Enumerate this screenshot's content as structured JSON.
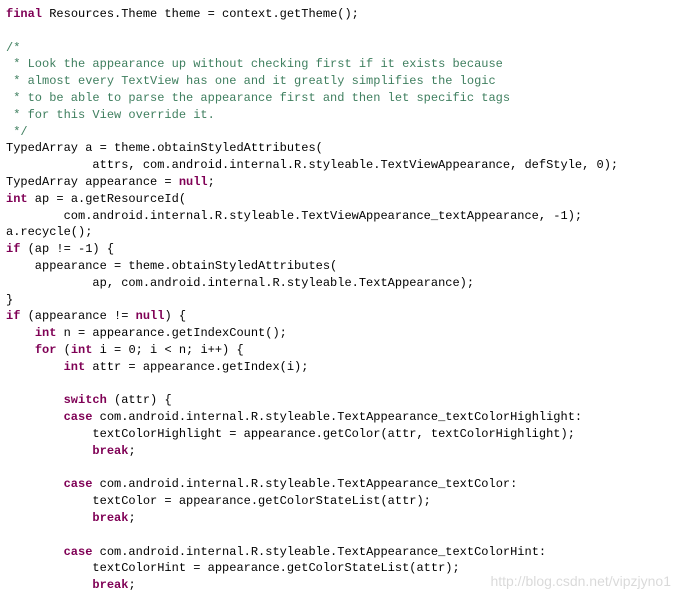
{
  "lines": [
    {
      "segments": [
        {
          "t": "final",
          "c": "keyword"
        },
        {
          "t": " Resources.Theme theme = context.getTheme();",
          "c": "literal"
        }
      ]
    },
    {
      "segments": [
        {
          "t": "",
          "c": "literal"
        }
      ]
    },
    {
      "segments": [
        {
          "t": "/*",
          "c": "comment"
        }
      ]
    },
    {
      "segments": [
        {
          "t": " * Look the appearance up without checking first if it exists because",
          "c": "comment"
        }
      ]
    },
    {
      "segments": [
        {
          "t": " * almost every TextView has one and it greatly simplifies the logic",
          "c": "comment"
        }
      ]
    },
    {
      "segments": [
        {
          "t": " * to be able to parse the appearance first and then let specific tags",
          "c": "comment"
        }
      ]
    },
    {
      "segments": [
        {
          "t": " * for this View override it.",
          "c": "comment"
        }
      ]
    },
    {
      "segments": [
        {
          "t": " */",
          "c": "comment"
        }
      ]
    },
    {
      "segments": [
        {
          "t": "TypedArray a = theme.obtainStyledAttributes(",
          "c": "literal"
        }
      ]
    },
    {
      "segments": [
        {
          "t": "            attrs, com.android.internal.R.styleable.TextViewAppearance, defStyle, 0);",
          "c": "literal"
        }
      ]
    },
    {
      "segments": [
        {
          "t": "TypedArray appearance = ",
          "c": "literal"
        },
        {
          "t": "null",
          "c": "keyword"
        },
        {
          "t": ";",
          "c": "literal"
        }
      ]
    },
    {
      "segments": [
        {
          "t": "int",
          "c": "keyword"
        },
        {
          "t": " ap = a.getResourceId(",
          "c": "literal"
        }
      ]
    },
    {
      "segments": [
        {
          "t": "        com.android.internal.R.styleable.TextViewAppearance_textAppearance, -1);",
          "c": "literal"
        }
      ]
    },
    {
      "segments": [
        {
          "t": "a.recycle();",
          "c": "literal"
        }
      ]
    },
    {
      "segments": [
        {
          "t": "if",
          "c": "keyword"
        },
        {
          "t": " (ap != -1) {",
          "c": "literal"
        }
      ]
    },
    {
      "segments": [
        {
          "t": "    appearance = theme.obtainStyledAttributes(",
          "c": "literal"
        }
      ]
    },
    {
      "segments": [
        {
          "t": "            ap, com.android.internal.R.styleable.TextAppearance);",
          "c": "literal"
        }
      ]
    },
    {
      "segments": [
        {
          "t": "}",
          "c": "literal"
        }
      ]
    },
    {
      "segments": [
        {
          "t": "if",
          "c": "keyword"
        },
        {
          "t": " (appearance != ",
          "c": "literal"
        },
        {
          "t": "null",
          "c": "keyword"
        },
        {
          "t": ") {",
          "c": "literal"
        }
      ]
    },
    {
      "segments": [
        {
          "t": "    ",
          "c": "literal"
        },
        {
          "t": "int",
          "c": "keyword"
        },
        {
          "t": " n = appearance.getIndexCount();",
          "c": "literal"
        }
      ]
    },
    {
      "segments": [
        {
          "t": "    ",
          "c": "literal"
        },
        {
          "t": "for",
          "c": "keyword"
        },
        {
          "t": " (",
          "c": "literal"
        },
        {
          "t": "int",
          "c": "keyword"
        },
        {
          "t": " i = 0; i < n; i++) {",
          "c": "literal"
        }
      ]
    },
    {
      "segments": [
        {
          "t": "        ",
          "c": "literal"
        },
        {
          "t": "int",
          "c": "keyword"
        },
        {
          "t": " attr = appearance.getIndex(i);",
          "c": "literal"
        }
      ]
    },
    {
      "segments": [
        {
          "t": "",
          "c": "literal"
        }
      ]
    },
    {
      "segments": [
        {
          "t": "        ",
          "c": "literal"
        },
        {
          "t": "switch",
          "c": "keyword"
        },
        {
          "t": " (attr) {",
          "c": "literal"
        }
      ]
    },
    {
      "segments": [
        {
          "t": "        ",
          "c": "literal"
        },
        {
          "t": "case",
          "c": "keyword"
        },
        {
          "t": " com.android.internal.R.styleable.TextAppearance_textColorHighlight:",
          "c": "literal"
        }
      ]
    },
    {
      "segments": [
        {
          "t": "            textColorHighlight = appearance.getColor(attr, textColorHighlight);",
          "c": "literal"
        }
      ]
    },
    {
      "segments": [
        {
          "t": "            ",
          "c": "literal"
        },
        {
          "t": "break",
          "c": "keyword"
        },
        {
          "t": ";",
          "c": "literal"
        }
      ]
    },
    {
      "segments": [
        {
          "t": "",
          "c": "literal"
        }
      ]
    },
    {
      "segments": [
        {
          "t": "        ",
          "c": "literal"
        },
        {
          "t": "case",
          "c": "keyword"
        },
        {
          "t": " com.android.internal.R.styleable.TextAppearance_textColor:",
          "c": "literal"
        }
      ]
    },
    {
      "segments": [
        {
          "t": "            textColor = appearance.getColorStateList(attr);",
          "c": "literal"
        }
      ]
    },
    {
      "segments": [
        {
          "t": "            ",
          "c": "literal"
        },
        {
          "t": "break",
          "c": "keyword"
        },
        {
          "t": ";",
          "c": "literal"
        }
      ]
    },
    {
      "segments": [
        {
          "t": "",
          "c": "literal"
        }
      ]
    },
    {
      "segments": [
        {
          "t": "        ",
          "c": "literal"
        },
        {
          "t": "case",
          "c": "keyword"
        },
        {
          "t": " com.android.internal.R.styleable.TextAppearance_textColorHint:",
          "c": "literal"
        }
      ]
    },
    {
      "segments": [
        {
          "t": "            textColorHint = appearance.getColorStateList(attr);",
          "c": "literal"
        }
      ]
    },
    {
      "segments": [
        {
          "t": "            ",
          "c": "literal"
        },
        {
          "t": "break",
          "c": "keyword"
        },
        {
          "t": ";",
          "c": "literal"
        }
      ]
    }
  ],
  "watermark": "http://blog.csdn.net/vipzjyno1"
}
